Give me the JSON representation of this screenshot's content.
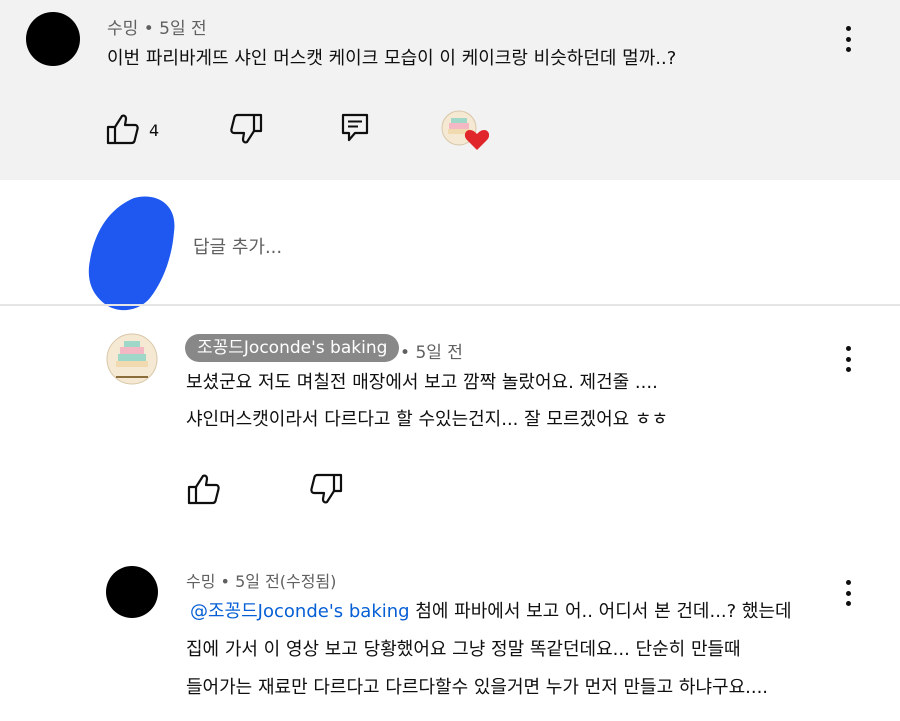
{
  "comment1": {
    "author": "수밍",
    "time": "5일 전",
    "text": "이번 파리바게뜨 샤인 머스캣 케이크 모습이 이 케이크랑 비슷하던데 멀까..?",
    "likes": "4",
    "heart_avatar_text": "Joconde's Baking"
  },
  "reply_box": {
    "placeholder": "답글 추가..."
  },
  "reply1": {
    "author": "조꽁드Joconde's baking",
    "time": "5일 전",
    "line1": "보셨군요 저도 며칠전 매장에서 보고 깜짝 놀랐어요. 제건줄 ....",
    "line2": "샤인머스캣이라서 다르다고 할 수있는건지... 잘 모르겠어요 ㅎㅎ",
    "avatar_text": "Joconde's Baking"
  },
  "reply2": {
    "author": "수밍",
    "time": "5일 전(수정됨)",
    "mention": "@조꽁드Joconde's baking",
    "line1_rest": " 첨에 파바에서 보고 어.. 어디서 본 건데...? 했는데",
    "line2": "집에 가서 이 영상 보고 당황했어요 그냥 정말 똑같던데요... 단순히 만들때",
    "line3": "들어가는 재료만 다르다고 다르다할수 있을거면 누가 먼저 만들고 하냐구요...."
  },
  "colors": {
    "background_top": "#f2f2f2",
    "mention": "#065fd4",
    "heart": "#e0262b",
    "scribble": "#1e58f0",
    "chip": "#888888"
  },
  "icons": [
    "like-icon",
    "dislike-icon",
    "reply-icon",
    "heart-icon",
    "more-icon"
  ]
}
